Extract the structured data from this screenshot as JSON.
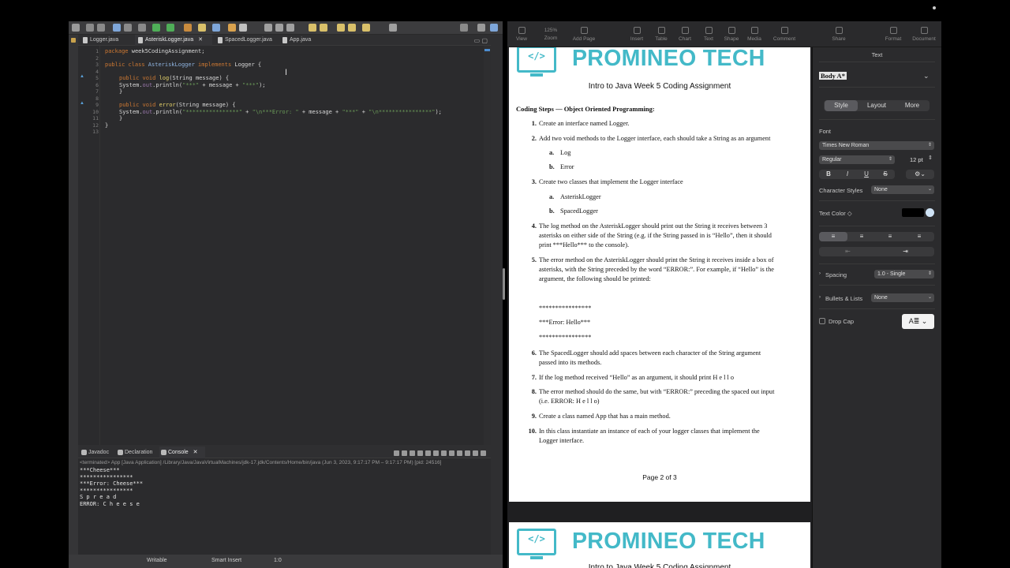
{
  "eclipse": {
    "editor_tabs": [
      {
        "label": "Logger.java",
        "active": false
      },
      {
        "label": "AsteriskLogger.java",
        "active": true
      },
      {
        "label": "SpacedLogger.java",
        "active": false
      },
      {
        "label": "App.java",
        "active": false
      }
    ],
    "close_glyph": "✕",
    "line_numbers": [
      "1",
      "2",
      "3",
      "4",
      "5",
      "6",
      "7",
      "8",
      "9",
      "10",
      "11",
      "12",
      "13"
    ],
    "code": {
      "l1_kw": "package",
      "l1_rest": " week5CodingAssignment;",
      "l3_kw1": "public class",
      "l3_cls": "AsteriskLogger",
      "l3_kw2": "implements",
      "l3_rest": " Logger {",
      "l5_kw": "public void",
      "l5_mth": "log",
      "l5_rest": "(String message) {",
      "l6_a": "System.",
      "l6_fld": "out",
      "l6_b": ".println(",
      "l6_s1": "\"***\"",
      "l6_c": " + message + ",
      "l6_s2": "\"***\"",
      "l6_d": ");",
      "l7": "}",
      "l9_kw": "public void",
      "l9_mth": "error",
      "l9_rest": "(String message) {",
      "l10_a": "System.",
      "l10_fld": "out",
      "l10_b": ".println(",
      "l10_s1": "\"****************\"",
      "l10_c": " + ",
      "l10_s2": "\"\\n***Error: \"",
      "l10_d": " + message + ",
      "l10_s3": "\"***\"",
      "l10_e": " + ",
      "l10_s4": "\"\\n****************\"",
      "l10_f": ");",
      "l11": "}",
      "l12": "}"
    },
    "console_tabs": [
      {
        "label": "Javadoc",
        "active": false
      },
      {
        "label": "Declaration",
        "active": false
      },
      {
        "label": "Console",
        "active": true
      }
    ],
    "console_header": "<terminated> App [Java Application] /Library/Java/JavaVirtualMachines/jdk-17.jdk/Contents/Home/bin/java  (Jun 3, 2023, 9:17:17 PM – 9:17:17 PM) [pid: 24516]",
    "console_output": [
      "***Cheese***",
      "****************",
      "***Error: Cheese***",
      "****************",
      "S p r e a d",
      "ERROR: C h e e s e"
    ],
    "status": {
      "writable": "Writable",
      "insert_mode": "Smart Insert",
      "position": "1:0"
    }
  },
  "pages_app": {
    "toolbar": [
      {
        "label": "View"
      },
      {
        "label": "Zoom",
        "value": "125%"
      },
      {
        "label": "Add Page"
      },
      {
        "label": "Insert"
      },
      {
        "label": "Table"
      },
      {
        "label": "Chart"
      },
      {
        "label": "Text"
      },
      {
        "label": "Shape"
      },
      {
        "label": "Media"
      },
      {
        "label": "Comment"
      },
      {
        "label": "Share"
      },
      {
        "label": "Format"
      },
      {
        "label": "Document"
      }
    ],
    "document": {
      "logo_text": "PROMINEO TECH",
      "logo_code": "</>",
      "title": "Intro to Java Week 5 Coding Assignment",
      "heading": "Coding Steps — Object Oriented Programming:",
      "steps": [
        {
          "n": "1.",
          "text": "Create an interface named Logger."
        },
        {
          "n": "2.",
          "text": "Add two void methods to the Logger interface, each should take a String as an argument"
        },
        {
          "n": "a.",
          "text": "Log"
        },
        {
          "n": "b.",
          "text": "Error"
        },
        {
          "n": "3.",
          "text": "Create two classes that implement the Logger interface"
        },
        {
          "n": "a.",
          "text": "AsteriskLogger"
        },
        {
          "n": "b.",
          "text": "SpacedLogger"
        },
        {
          "n": "4.",
          "lines": [
            "The log method on the AsteriskLogger should print out the String it receives between 3",
            "asterisks on either side of the String (e.g. if the String passed in is “Hello”, then it should",
            "print ***Hello*** to the console)."
          ]
        },
        {
          "n": "5.",
          "lines": [
            "The error method on the AsteriskLogger should print the String it receives inside a box of",
            "asterisks, with the String preceded by the word “ERROR:”. For example, if “Hello” is the",
            "argument, the following should be printed:"
          ]
        },
        {
          "n": "",
          "text": "****************"
        },
        {
          "n": "",
          "text": "***Error: Hello***"
        },
        {
          "n": "",
          "text": "****************"
        },
        {
          "n": "6.",
          "lines": [
            "The SpacedLogger should add spaces between each character of the String argument",
            "passed into its methods."
          ]
        },
        {
          "n": "7.",
          "text": "If the log method received “Hello” as an argument, it should print H e l l o"
        },
        {
          "n": "8.",
          "lines": [
            "The error method should do the same, but with “ERROR:” preceding the spaced out input",
            "(i.e. ERROR: H e l l o)"
          ]
        },
        {
          "n": "9.",
          "text": "Create a class named App that has a main method."
        },
        {
          "n": "10.",
          "lines": [
            "In this class instantiate an instance of each of your logger classes that implement the",
            "Logger interface."
          ]
        }
      ],
      "footer": "Page 2 of 3"
    },
    "inspector": {
      "section_title": "Text",
      "paragraph_style": "Body A*",
      "tabs": [
        "Style",
        "Layout",
        "More"
      ],
      "active_tab": "Style",
      "font_label": "Font",
      "font_family": "Times New Roman",
      "font_weight": "Regular",
      "font_size": "12 pt",
      "format_buttons": [
        "B",
        "I",
        "U",
        "S"
      ],
      "character_styles_label": "Character Styles",
      "character_styles_value": "None",
      "text_color_label": "Text Color ◇",
      "spacing_label": "Spacing",
      "spacing_value": "1.0 - Single",
      "bullets_label": "Bullets & Lists",
      "bullets_value": "None",
      "drop_cap_label": "Drop Cap"
    }
  }
}
